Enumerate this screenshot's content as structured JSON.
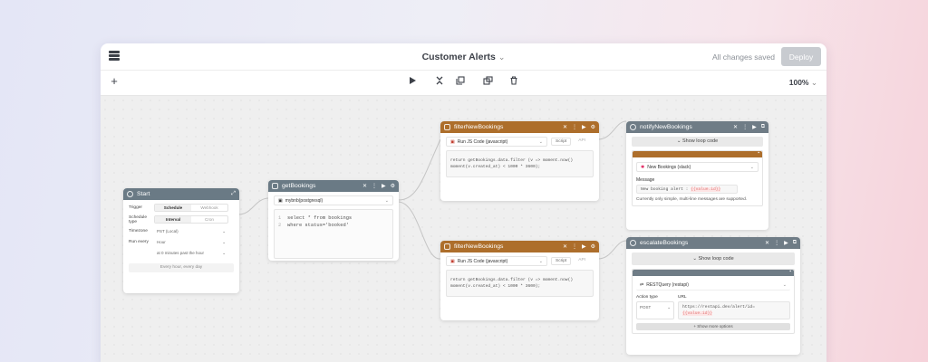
{
  "app": {
    "title": "Customer Alerts",
    "status": "All changes saved",
    "deploy_label": "Deploy",
    "zoom": "100%"
  },
  "toolbar": {
    "icons": [
      "plus-icon",
      "play-icon",
      "collapse-icon",
      "duplicate-icon",
      "copy-icon",
      "trash-icon"
    ]
  },
  "nodes": {
    "start": {
      "title": "Start",
      "trigger_label": "Trigger",
      "trigger_opts": [
        "Schedule",
        "Webhook"
      ],
      "schedule_type_label": "Schedule type",
      "schedule_type_opts": [
        "Interval",
        "Cron"
      ],
      "timezone_label": "Timezone",
      "timezone_value": "PST (Local)",
      "run_every_label": "Run every",
      "run_every_value": "Hour",
      "run_every_sub": "at 0 minutes past the hour",
      "summary": "Every hour, every day"
    },
    "getBookings": {
      "title": "getBookings",
      "resource": "mybnb(postgresql)",
      "line_nums": [
        "1",
        "2"
      ],
      "code": [
        "select * from bookings",
        "where status='booked'"
      ]
    },
    "filter1": {
      "title": "filterNewBookings",
      "run": "Run JS Code (javascript)",
      "tab_script": "Script",
      "tab_api": "API",
      "code": [
        "return getBookings.data.filter (v => moment.now()",
        "moment(v.created_at) < 1000 * 3600);"
      ]
    },
    "notify": {
      "title": "notifyNewBookings",
      "loop": "Show loop code",
      "channel": "New Bookings (slack)",
      "msg_label": "Message",
      "msg_prefix": "New booking alert :",
      "msg_var": "{{value.id}}",
      "note": "Currently only simple, multi-line messages are supported."
    },
    "filter2": {
      "title": "filterNewBookings",
      "run": "Run JS Code (javascript)",
      "tab_script": "Script",
      "tab_api": "API",
      "code": [
        "return getBookings.data.filter (v => moment.now()",
        "moment(v.created_at) < 1000 * 3600);"
      ]
    },
    "escalate": {
      "title": "escalateBookings",
      "loop": "Show loop code",
      "api": "RESTQuery (restapi)",
      "action_label": "Action type",
      "url_label": "URL",
      "action_value": "POST",
      "url_value": "https://restapi.dev/alert/id=",
      "url_var": "{{value.id}}",
      "more": "+ Show more options"
    }
  }
}
